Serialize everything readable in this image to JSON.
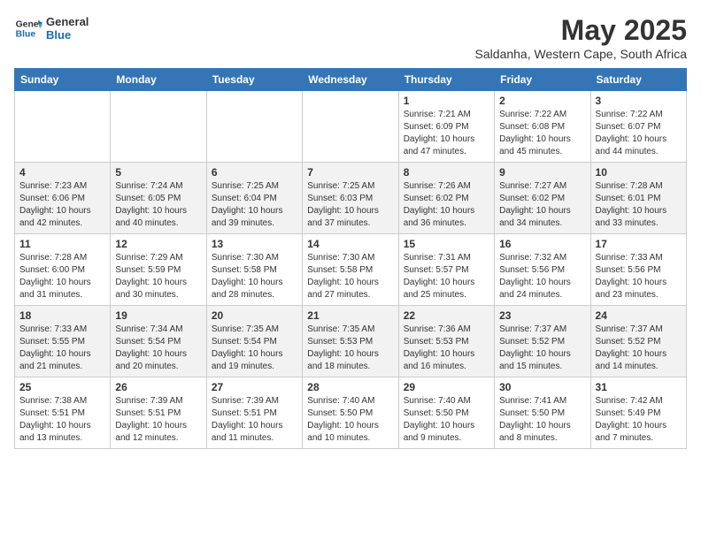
{
  "header": {
    "logo_line1": "General",
    "logo_line2": "Blue",
    "month_year": "May 2025",
    "location": "Saldanha, Western Cape, South Africa"
  },
  "weekdays": [
    "Sunday",
    "Monday",
    "Tuesday",
    "Wednesday",
    "Thursday",
    "Friday",
    "Saturday"
  ],
  "weeks": [
    [
      {
        "day": "",
        "info": ""
      },
      {
        "day": "",
        "info": ""
      },
      {
        "day": "",
        "info": ""
      },
      {
        "day": "",
        "info": ""
      },
      {
        "day": "1",
        "info": "Sunrise: 7:21 AM\nSunset: 6:09 PM\nDaylight: 10 hours\nand 47 minutes."
      },
      {
        "day": "2",
        "info": "Sunrise: 7:22 AM\nSunset: 6:08 PM\nDaylight: 10 hours\nand 45 minutes."
      },
      {
        "day": "3",
        "info": "Sunrise: 7:22 AM\nSunset: 6:07 PM\nDaylight: 10 hours\nand 44 minutes."
      }
    ],
    [
      {
        "day": "4",
        "info": "Sunrise: 7:23 AM\nSunset: 6:06 PM\nDaylight: 10 hours\nand 42 minutes."
      },
      {
        "day": "5",
        "info": "Sunrise: 7:24 AM\nSunset: 6:05 PM\nDaylight: 10 hours\nand 40 minutes."
      },
      {
        "day": "6",
        "info": "Sunrise: 7:25 AM\nSunset: 6:04 PM\nDaylight: 10 hours\nand 39 minutes."
      },
      {
        "day": "7",
        "info": "Sunrise: 7:25 AM\nSunset: 6:03 PM\nDaylight: 10 hours\nand 37 minutes."
      },
      {
        "day": "8",
        "info": "Sunrise: 7:26 AM\nSunset: 6:02 PM\nDaylight: 10 hours\nand 36 minutes."
      },
      {
        "day": "9",
        "info": "Sunrise: 7:27 AM\nSunset: 6:02 PM\nDaylight: 10 hours\nand 34 minutes."
      },
      {
        "day": "10",
        "info": "Sunrise: 7:28 AM\nSunset: 6:01 PM\nDaylight: 10 hours\nand 33 minutes."
      }
    ],
    [
      {
        "day": "11",
        "info": "Sunrise: 7:28 AM\nSunset: 6:00 PM\nDaylight: 10 hours\nand 31 minutes."
      },
      {
        "day": "12",
        "info": "Sunrise: 7:29 AM\nSunset: 5:59 PM\nDaylight: 10 hours\nand 30 minutes."
      },
      {
        "day": "13",
        "info": "Sunrise: 7:30 AM\nSunset: 5:58 PM\nDaylight: 10 hours\nand 28 minutes."
      },
      {
        "day": "14",
        "info": "Sunrise: 7:30 AM\nSunset: 5:58 PM\nDaylight: 10 hours\nand 27 minutes."
      },
      {
        "day": "15",
        "info": "Sunrise: 7:31 AM\nSunset: 5:57 PM\nDaylight: 10 hours\nand 25 minutes."
      },
      {
        "day": "16",
        "info": "Sunrise: 7:32 AM\nSunset: 5:56 PM\nDaylight: 10 hours\nand 24 minutes."
      },
      {
        "day": "17",
        "info": "Sunrise: 7:33 AM\nSunset: 5:56 PM\nDaylight: 10 hours\nand 23 minutes."
      }
    ],
    [
      {
        "day": "18",
        "info": "Sunrise: 7:33 AM\nSunset: 5:55 PM\nDaylight: 10 hours\nand 21 minutes."
      },
      {
        "day": "19",
        "info": "Sunrise: 7:34 AM\nSunset: 5:54 PM\nDaylight: 10 hours\nand 20 minutes."
      },
      {
        "day": "20",
        "info": "Sunrise: 7:35 AM\nSunset: 5:54 PM\nDaylight: 10 hours\nand 19 minutes."
      },
      {
        "day": "21",
        "info": "Sunrise: 7:35 AM\nSunset: 5:53 PM\nDaylight: 10 hours\nand 18 minutes."
      },
      {
        "day": "22",
        "info": "Sunrise: 7:36 AM\nSunset: 5:53 PM\nDaylight: 10 hours\nand 16 minutes."
      },
      {
        "day": "23",
        "info": "Sunrise: 7:37 AM\nSunset: 5:52 PM\nDaylight: 10 hours\nand 15 minutes."
      },
      {
        "day": "24",
        "info": "Sunrise: 7:37 AM\nSunset: 5:52 PM\nDaylight: 10 hours\nand 14 minutes."
      }
    ],
    [
      {
        "day": "25",
        "info": "Sunrise: 7:38 AM\nSunset: 5:51 PM\nDaylight: 10 hours\nand 13 minutes."
      },
      {
        "day": "26",
        "info": "Sunrise: 7:39 AM\nSunset: 5:51 PM\nDaylight: 10 hours\nand 12 minutes."
      },
      {
        "day": "27",
        "info": "Sunrise: 7:39 AM\nSunset: 5:51 PM\nDaylight: 10 hours\nand 11 minutes."
      },
      {
        "day": "28",
        "info": "Sunrise: 7:40 AM\nSunset: 5:50 PM\nDaylight: 10 hours\nand 10 minutes."
      },
      {
        "day": "29",
        "info": "Sunrise: 7:40 AM\nSunset: 5:50 PM\nDaylight: 10 hours\nand 9 minutes."
      },
      {
        "day": "30",
        "info": "Sunrise: 7:41 AM\nSunset: 5:50 PM\nDaylight: 10 hours\nand 8 minutes."
      },
      {
        "day": "31",
        "info": "Sunrise: 7:42 AM\nSunset: 5:49 PM\nDaylight: 10 hours\nand 7 minutes."
      }
    ]
  ]
}
